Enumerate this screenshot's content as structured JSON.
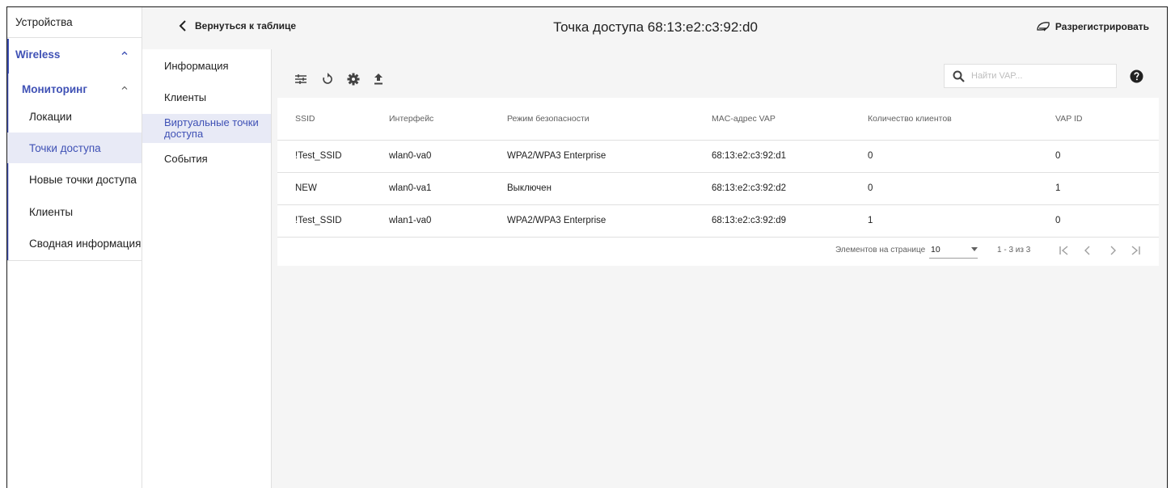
{
  "sidebar": {
    "devices": "Устройства",
    "wireless": "Wireless",
    "monitoring": "Мониторинг",
    "items": [
      {
        "label": "Локации"
      },
      {
        "label": "Точки доступа"
      },
      {
        "label": "Новые точки доступа"
      },
      {
        "label": "Клиенты"
      },
      {
        "label": "Сводная информация"
      }
    ]
  },
  "header": {
    "back_label": "Вернуться к таблице",
    "title": "Точка доступа 68:13:e2:c3:92:d0",
    "unregister_label": "Разрегистрировать"
  },
  "subnav": {
    "items": [
      {
        "label": "Информация"
      },
      {
        "label": "Клиенты"
      },
      {
        "label": "Виртуальные точки доступа"
      },
      {
        "label": "События"
      }
    ]
  },
  "toolbar": {
    "icons": [
      "tune-icon",
      "refresh-icon",
      "settings-icon",
      "upload-icon"
    ],
    "search_placeholder": "Найти VAP...",
    "help_icon": "help-icon"
  },
  "table": {
    "columns": [
      "SSID",
      "Интерфейс",
      "Режим безопасности",
      "MAC-адрес VAP",
      "Количество клиентов",
      "VAP ID"
    ],
    "rows": [
      [
        "!Test_SSID",
        "wlan0-va0",
        "WPA2/WPA3 Enterprise",
        "68:13:e2:c3:92:d1",
        "0",
        "0"
      ],
      [
        "NEW",
        "wlan0-va1",
        "Выключен",
        "68:13:e2:c3:92:d2",
        "0",
        "1"
      ],
      [
        "!Test_SSID",
        "wlan1-va0",
        "WPA2/WPA3 Enterprise",
        "68:13:e2:c3:92:d9",
        "1",
        "0"
      ]
    ]
  },
  "paginator": {
    "items_per_page_label": "Элементов на странице",
    "page_size": "10",
    "range_label": "1 - 3 из 3"
  },
  "colors": {
    "accent": "#3f51b5",
    "active_bg": "#e8eaf6",
    "header_bg": "#f5f5f5"
  }
}
